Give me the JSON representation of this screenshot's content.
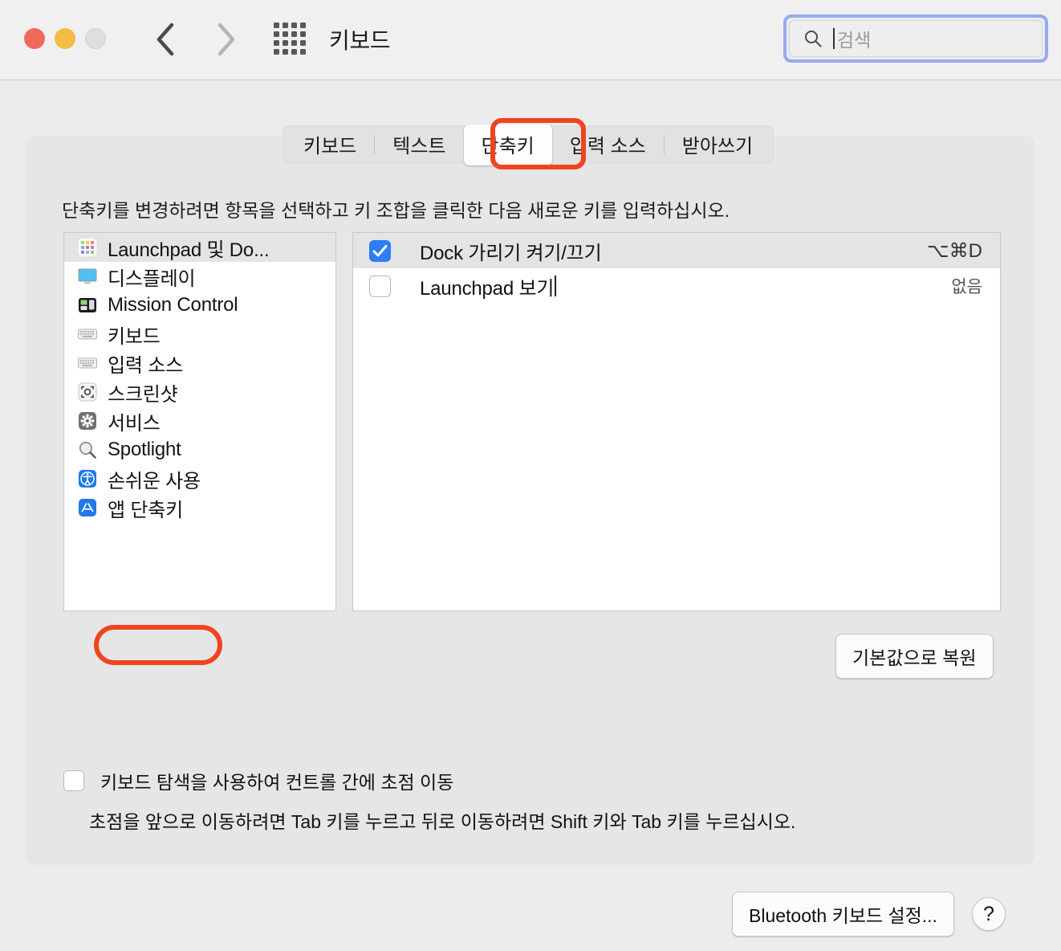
{
  "window": {
    "title": "키보드",
    "traffic_lights": [
      "close",
      "minimize",
      "zoom"
    ],
    "back_icon": "chevron-left-icon",
    "forward_icon": "chevron-right-icon",
    "grid_icon": "grid-apps-icon"
  },
  "search": {
    "icon": "search-icon",
    "placeholder": "검색",
    "value": "",
    "focused": true,
    "focus_color": "#96aaf0"
  },
  "tabs": [
    {
      "label": "키보드",
      "selected": false
    },
    {
      "label": "텍스트",
      "selected": false
    },
    {
      "label": "단축키",
      "selected": true
    },
    {
      "label": "입력 소스",
      "selected": false
    },
    {
      "label": "받아쓰기",
      "selected": false
    }
  ],
  "annotations": {
    "color": "#f0441f",
    "tab_target": "단축키",
    "sidebar_target": "앱 단축키"
  },
  "instruction": "단축키를 변경하려면 항목을 선택하고 키 조합을 클릭한 다음 새로운 키를 입력하십시오.",
  "sidebar": {
    "items": [
      {
        "label": "Launchpad 및 Do...",
        "icon": "launchpad-icon",
        "selected": true
      },
      {
        "label": "디스플레이",
        "icon": "display-icon",
        "selected": false
      },
      {
        "label": "Mission Control",
        "icon": "mission-control-icon",
        "selected": false
      },
      {
        "label": "키보드",
        "icon": "keyboard-icon",
        "selected": false
      },
      {
        "label": "입력 소스",
        "icon": "keyboard-icon",
        "selected": false
      },
      {
        "label": "스크린샷",
        "icon": "screenshot-icon",
        "selected": false
      },
      {
        "label": "서비스",
        "icon": "gear-icon",
        "selected": false
      },
      {
        "label": "Spotlight",
        "icon": "spotlight-magnifier-icon",
        "selected": false
      },
      {
        "label": "손쉬운 사용",
        "icon": "accessibility-icon",
        "selected": false
      },
      {
        "label": "앱 단축키",
        "icon": "app-store-icon",
        "selected": false
      }
    ]
  },
  "shortcuts": {
    "rows": [
      {
        "name": "Dock 가리기 켜기/끄기",
        "checked": true,
        "key": "⌥⌘D",
        "highlighted": true,
        "editing": false
      },
      {
        "name": "Launchpad 보기",
        "checked": false,
        "key": "없음",
        "highlighted": false,
        "editing": true
      }
    ]
  },
  "buttons": {
    "restore_defaults": "기본값으로 복원",
    "bluetooth_keyboard": "Bluetooth 키보드 설정...",
    "help": "?"
  },
  "keyboard_navigation": {
    "checkbox_label": "키보드 탐색을 사용하여 컨트롤 간에 초점 이동",
    "checked": false,
    "help_text": "초점을 앞으로 이동하려면 Tab 키를 누르고 뒤로 이동하려면 Shift 키와 Tab 키를 누르십시오."
  }
}
